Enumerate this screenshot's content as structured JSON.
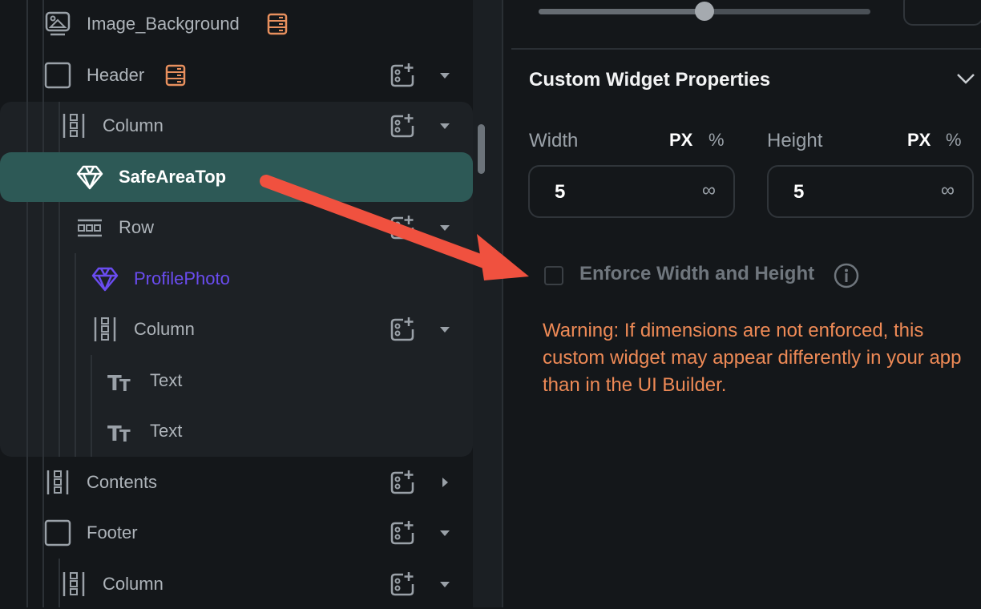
{
  "tree": {
    "items": [
      {
        "label": "Image_Background",
        "icon": "image-icon",
        "badge": "database-icon"
      },
      {
        "label": "Header",
        "icon": "container-icon",
        "badge": "database-icon",
        "expand": "caret-down"
      },
      {
        "label": "Column",
        "icon": "column-icon",
        "expand": "caret-down"
      },
      {
        "label": "SafeAreaTop",
        "icon": "custom-widget-diamond-icon",
        "selected": true
      },
      {
        "label": "Row",
        "icon": "row-icon",
        "expand": "caret-down"
      },
      {
        "label": "ProfilePhoto",
        "icon": "custom-widget-diamond-icon"
      },
      {
        "label": "Column",
        "icon": "column-icon",
        "expand": "caret-down"
      },
      {
        "label": "Text",
        "icon": "text-icon"
      },
      {
        "label": "Text",
        "icon": "text-icon"
      },
      {
        "label": "Contents",
        "icon": "column-icon",
        "expand": "caret-right"
      },
      {
        "label": "Footer",
        "icon": "container-icon",
        "expand": "caret-down"
      },
      {
        "label": "Column",
        "icon": "column-icon",
        "expand": "caret-down"
      }
    ]
  },
  "properties": {
    "slider_value": 0.5,
    "section_title": "Custom Widget Properties",
    "width_label": "Width",
    "height_label": "Height",
    "unit_px": "PX",
    "unit_pct": "%",
    "width_value": "5",
    "height_value": "5",
    "infinity": "∞",
    "enforce_label": "Enforce Width and Height",
    "enforce_checked": false,
    "warning": "Warning: If dimensions are not enforced, this custom widget may appear differently in your app than in the UI Builder."
  },
  "colors": {
    "selected_bg": "#2d5956",
    "warning": "#ee8a56",
    "badge": "#e8905e",
    "profile_photo": "#6a4cf0",
    "arrow": "#f0513f"
  }
}
